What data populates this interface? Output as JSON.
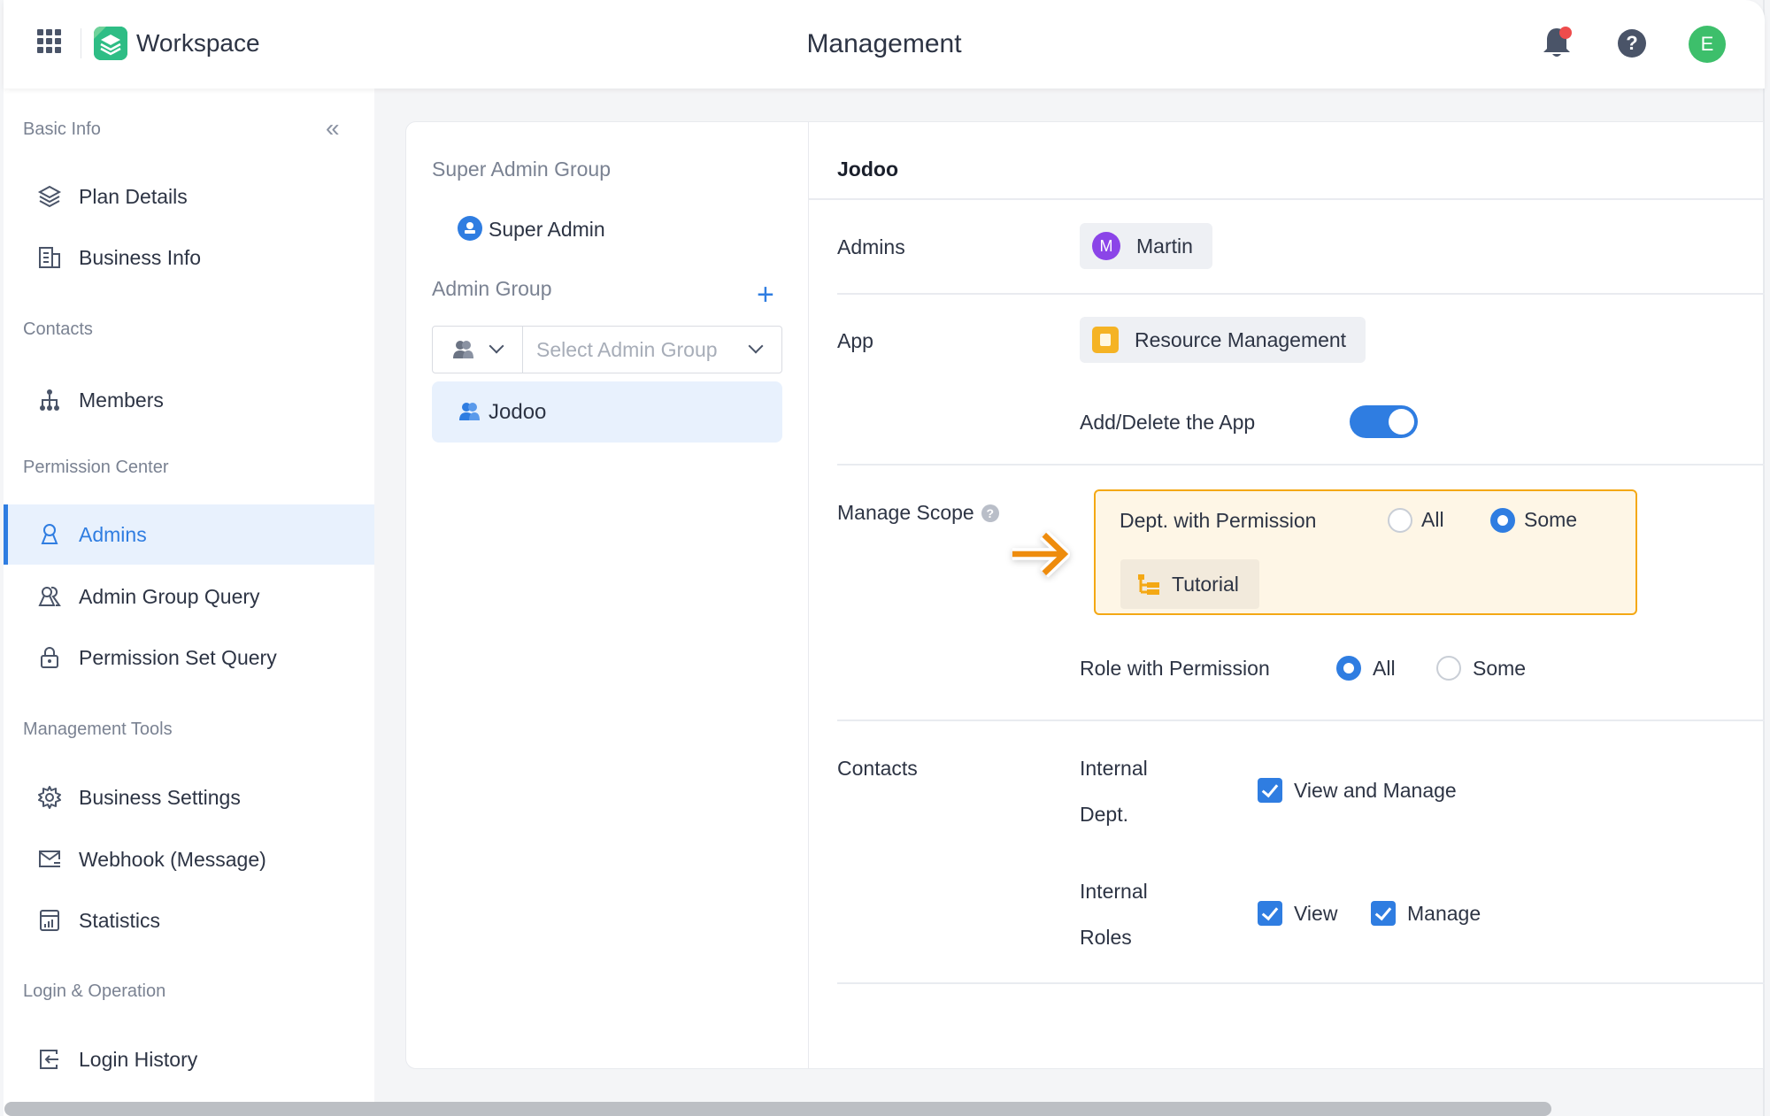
{
  "header": {
    "app_title": "Workspace",
    "page_title": "Management",
    "notification_dot": true,
    "help_label": "?",
    "user_initial": "E",
    "user_avatar_color": "#3dbf6b"
  },
  "sidebar": {
    "collapse_label": "«",
    "sections": [
      {
        "title": "Basic Info",
        "items": [
          {
            "label": "Plan Details",
            "icon": "layers-icon"
          },
          {
            "label": "Business Info",
            "icon": "building-icon"
          }
        ]
      },
      {
        "title": "Contacts",
        "items": [
          {
            "label": "Members",
            "icon": "org-chart-icon"
          }
        ]
      },
      {
        "title": "Permission Center",
        "items": [
          {
            "label": "Admins",
            "icon": "user-icon",
            "active": true
          },
          {
            "label": "Admin Group Query",
            "icon": "users-icon"
          },
          {
            "label": "Permission Set Query",
            "icon": "lock-icon"
          }
        ]
      },
      {
        "title": "Management Tools",
        "items": [
          {
            "label": "Business Settings",
            "icon": "gear-icon"
          },
          {
            "label": "Webhook (Message)",
            "icon": "mail-icon"
          },
          {
            "label": "Statistics",
            "icon": "chart-icon"
          }
        ]
      },
      {
        "title": "Login & Operation",
        "items": [
          {
            "label": "Login History",
            "icon": "login-icon"
          }
        ]
      }
    ]
  },
  "groups": {
    "super_group_title": "Super Admin Group",
    "super_admin_label": "Super Admin",
    "admin_group_title": "Admin Group",
    "add_label": "+",
    "select_placeholder": "Select Admin Group",
    "items": [
      {
        "label": "Jodoo",
        "selected": true
      }
    ]
  },
  "detail": {
    "title": "Jodoo",
    "admins_label": "Admins",
    "admin_initial": "M",
    "admin_name": "Martin",
    "admin_avatar_color": "#8b44e8",
    "app_label": "App",
    "app_name": "Resource Management",
    "add_delete_label": "Add/Delete the App",
    "add_delete_enabled": true,
    "manage_scope_label": "Manage Scope",
    "manage_scope_help": "?",
    "dept_permission_label": "Dept. with Permission",
    "dept_options": [
      "All",
      "Some"
    ],
    "dept_selected": "Some",
    "dept_selection": "Tutorial",
    "role_permission_label": "Role with Permission",
    "role_options": [
      "All",
      "Some"
    ],
    "role_selected": "All",
    "contacts_label": "Contacts",
    "internal_dept_label_1": "Internal",
    "internal_dept_label_2": "Dept.",
    "internal_dept_option": "View and Manage",
    "internal_dept_checked": true,
    "internal_roles_label_1": "Internal",
    "internal_roles_label_2": "Roles",
    "internal_roles_view": "View",
    "internal_roles_view_checked": true,
    "internal_roles_manage": "Manage",
    "internal_roles_manage_checked": true
  },
  "colors": {
    "accent": "#2f7de1",
    "highlight_border": "#f4a814",
    "highlight_bg": "#fef6e6",
    "arrow": "#ee8c10"
  }
}
